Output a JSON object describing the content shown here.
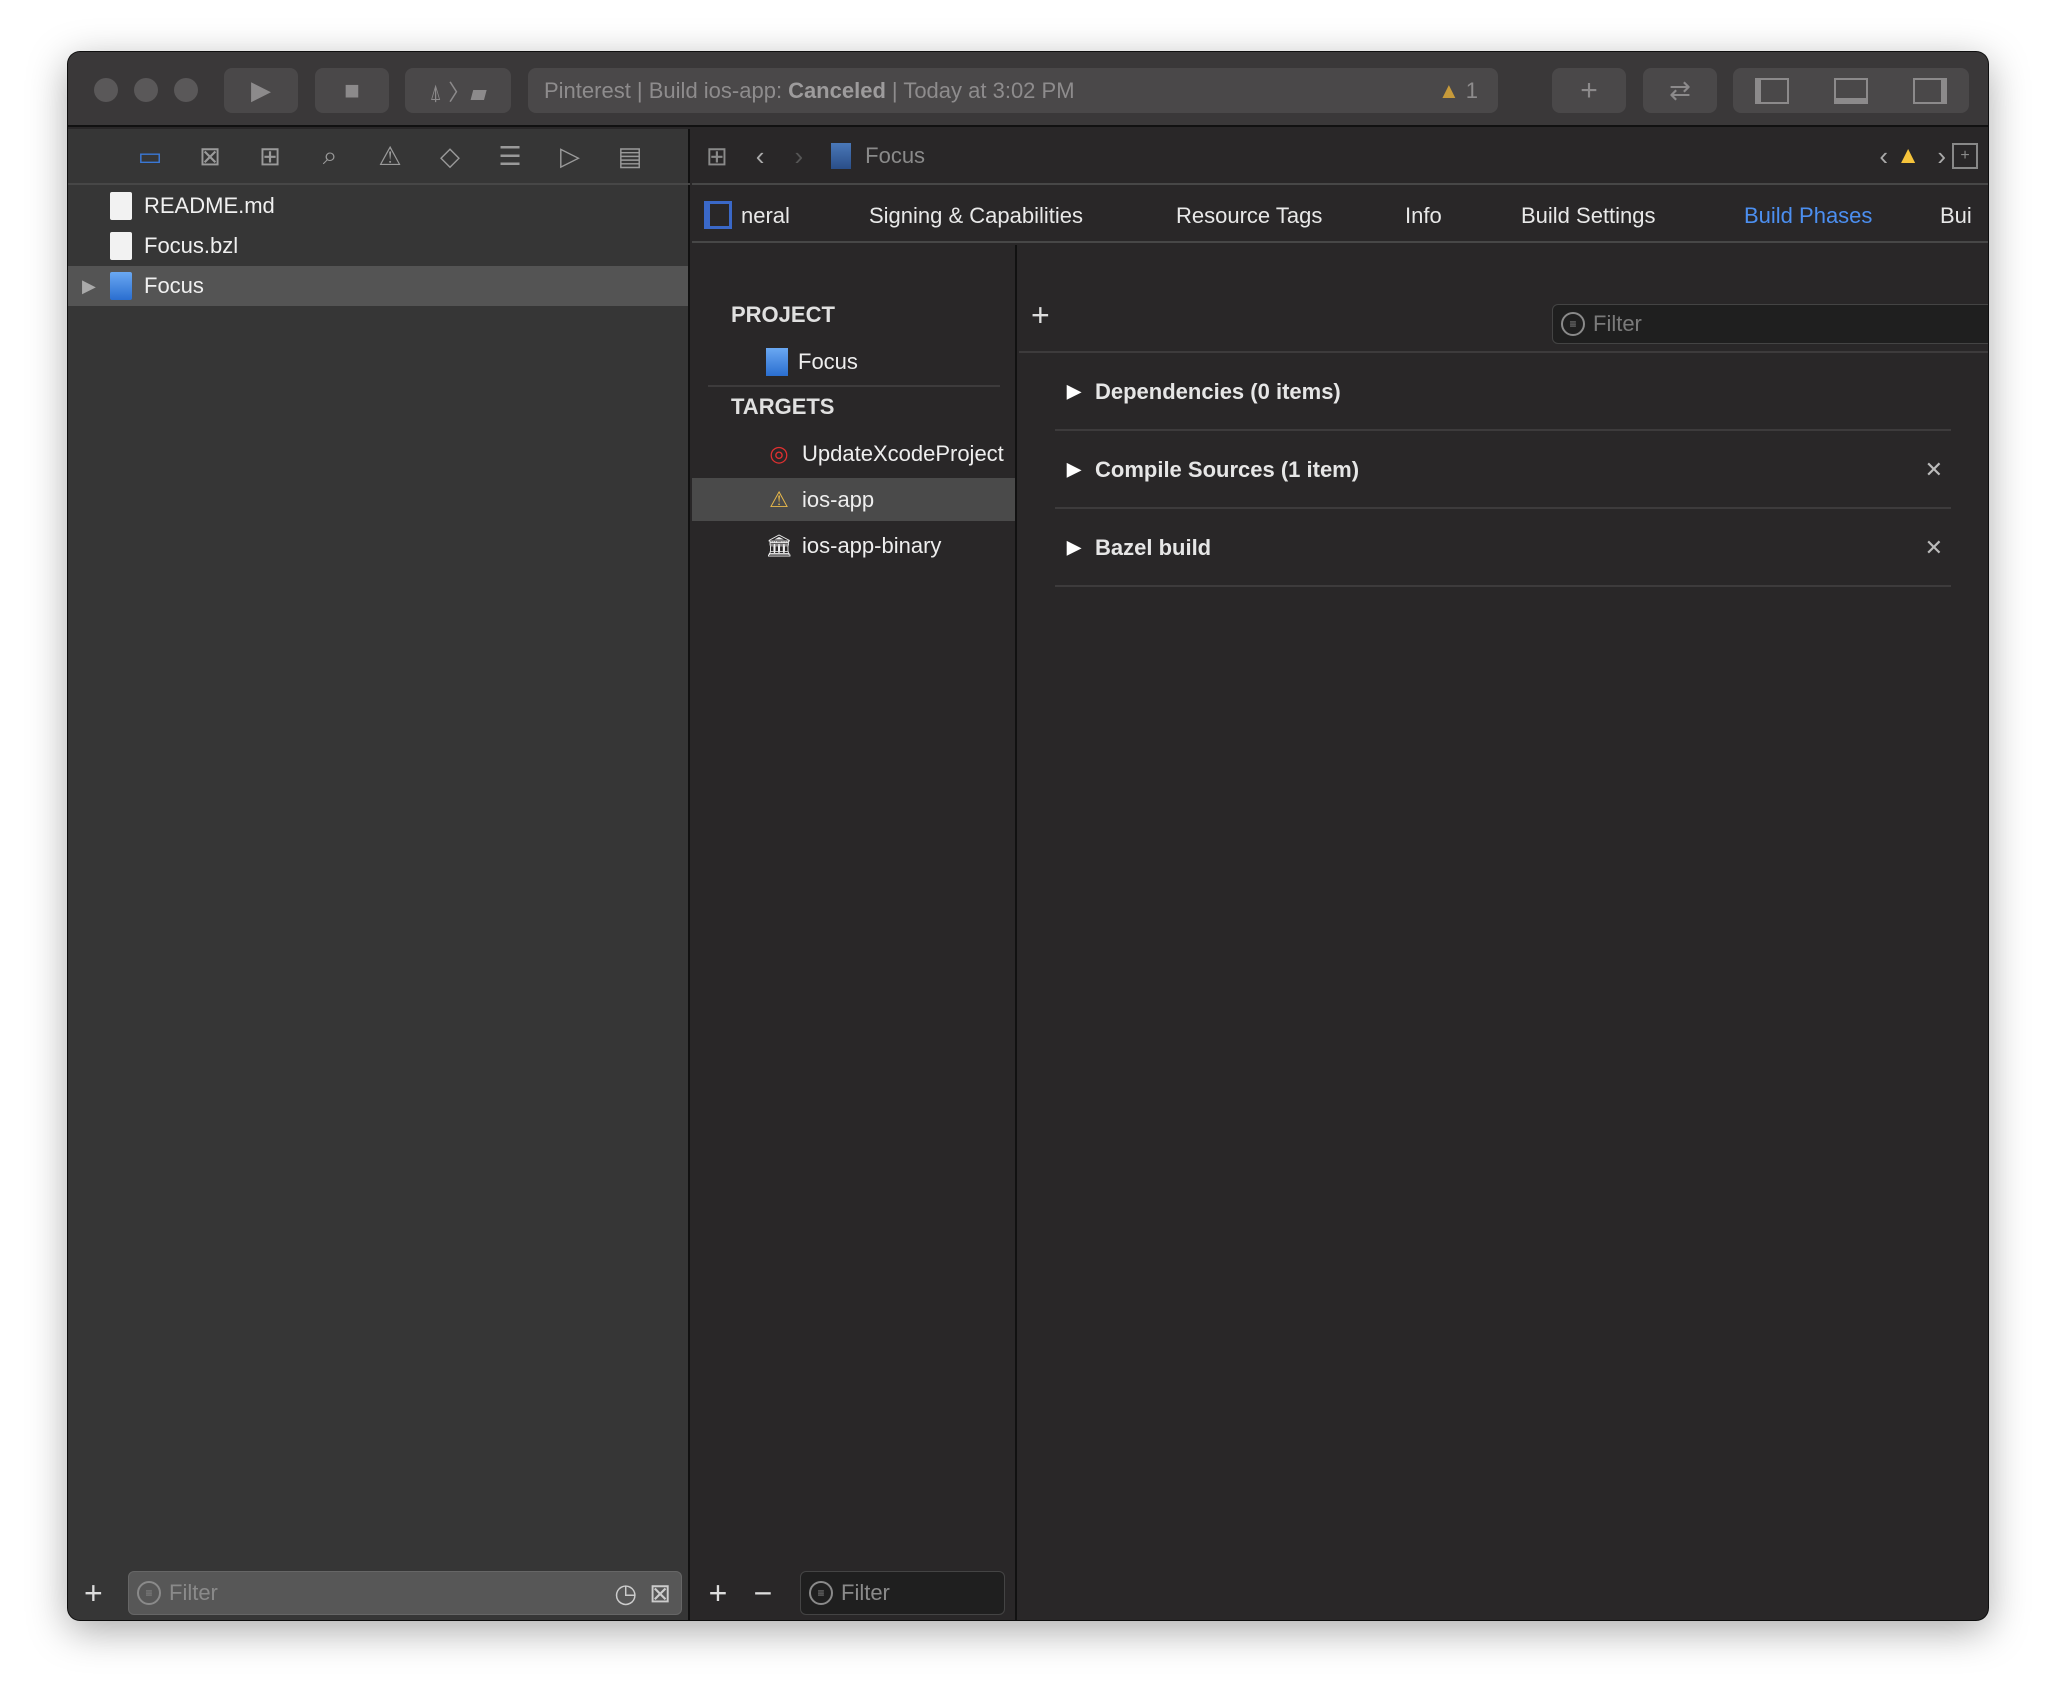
{
  "toolbar": {
    "activity": {
      "prefix": "Pinterest | Build ios-app:",
      "status": "Canceled",
      "suffix": "| Today at 3:02 PM",
      "warning_count": "1"
    },
    "icons": [
      "play-icon",
      "stop-icon",
      "scheme-icon",
      "add-icon",
      "swap-icon",
      "navigator-panel-icon",
      "debug-panel-icon",
      "inspector-panel-icon"
    ]
  },
  "navigator": {
    "files": [
      {
        "name": "README.md",
        "icon": "markdown-file-icon"
      },
      {
        "name": "Focus.bzl",
        "icon": "file-icon"
      },
      {
        "name": "Focus",
        "icon": "xcode-project-icon",
        "selected": true
      }
    ],
    "filter_placeholder": "Filter"
  },
  "jumpbar": {
    "path": "Focus"
  },
  "tabs": [
    "neral",
    "Signing & Capabilities",
    "Resource Tags",
    "Info",
    "Build Settings",
    "Build Phases",
    "Bui"
  ],
  "active_tab": "Build Phases",
  "targets_list": {
    "project_header": "PROJECT",
    "project": "Focus",
    "targets_header": "TARGETS",
    "targets": [
      "UpdateXcodeProject",
      "ios-app",
      "ios-app-binary"
    ],
    "selected": "ios-app",
    "filter_placeholder": "Filter"
  },
  "phases": {
    "filter_placeholder": "Filter",
    "items": [
      "Dependencies (0 items)",
      "Compile Sources (1 item)",
      "Bazel build"
    ]
  },
  "colors": {
    "accent": "#4c8ff0",
    "warning": "#f5c33b",
    "editor_bg": "#292728",
    "sidebar_bg": "#363636"
  }
}
